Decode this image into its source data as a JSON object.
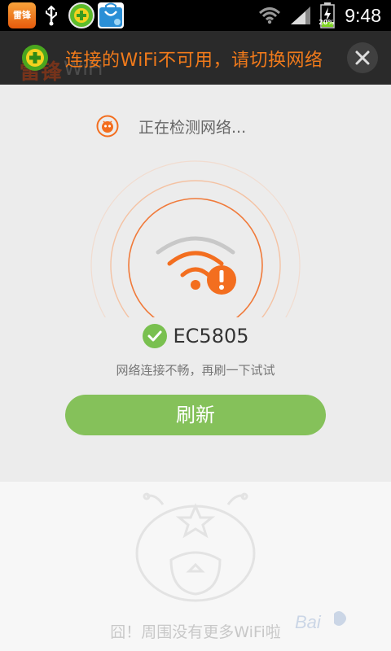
{
  "status_bar": {
    "time": "9:48",
    "battery_percent": "20%",
    "app_icons": [
      "leifeng-wifi-icon",
      "usb-icon",
      "360-security-icon",
      "app-store-bag-icon"
    ],
    "leifeng_icon_text": "雷锋"
  },
  "banner": {
    "message": "连接的WiFi不可用，请切换网络",
    "background_app_title": "雷锋",
    "background_app_subtitle": "WiFi",
    "colors": {
      "text": "#f07a1b",
      "background": "#2a2a2a"
    }
  },
  "detection": {
    "status_text": "正在检测网络...",
    "ssid": "EC5805",
    "hint": "网络连接不畅，再刷一下试试",
    "refresh_label": "刷新",
    "colors": {
      "accent": "#f36e1f",
      "button": "#85c15a",
      "check": "#79c04f"
    }
  },
  "empty_state": {
    "message": "囧！周围没有更多WiFi啦"
  },
  "watermark": {
    "text": "Bai"
  }
}
